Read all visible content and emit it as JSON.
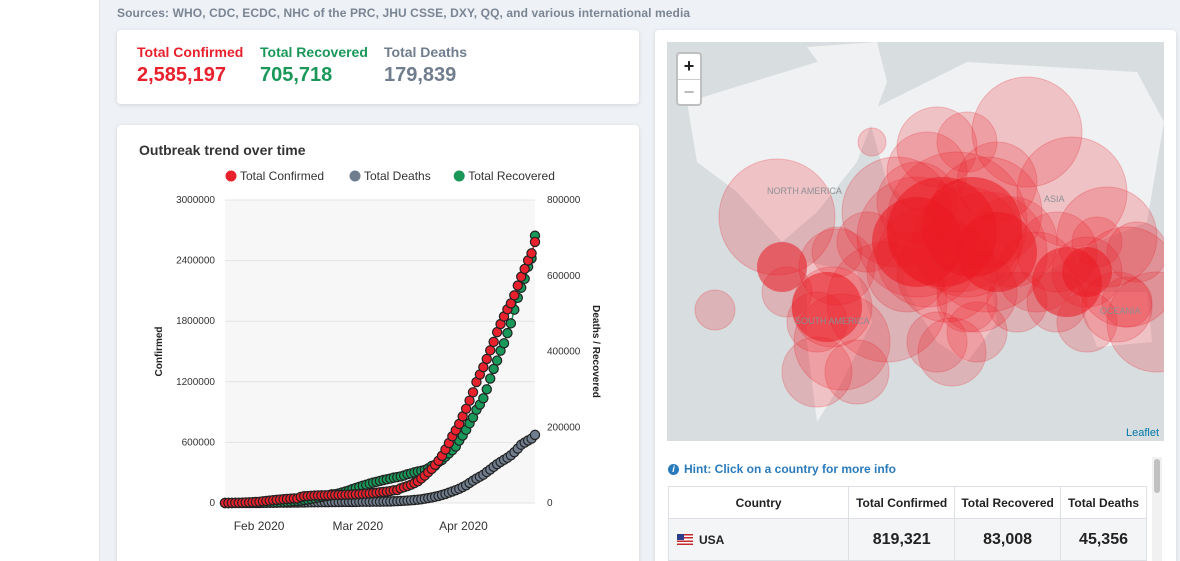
{
  "sources": "Sources: WHO, CDC, ECDC, NHC of the PRC, JHU CSSE, DXY, QQ, and various international media",
  "stats": {
    "confirmed_label": "Total Confirmed",
    "confirmed_value": "2,585,197",
    "recovered_label": "Total Recovered",
    "recovered_value": "705,718",
    "deaths_label": "Total Deaths",
    "deaths_value": "179,839",
    "colors": {
      "confirmed": "#e8212d",
      "recovered": "#19985a",
      "deaths": "#6f7d8e"
    }
  },
  "map": {
    "zoom_in": "+",
    "zoom_out": "−",
    "attribution": "Leaflet",
    "labels": [
      "NORTH AMERICA",
      "SOUTH AMERICA",
      "ASIA",
      "OCEANIA"
    ]
  },
  "hint": {
    "icon": "info-icon",
    "text": "Hint: Click on a country for more info"
  },
  "table": {
    "headers": [
      "Country",
      "Total Confirmed",
      "Total Recovered",
      "Total Deaths"
    ],
    "rows": [
      {
        "flag": "us-flag-icon",
        "country": "USA",
        "confirmed": "819,321",
        "recovered": "83,008",
        "deaths": "45,356"
      }
    ]
  },
  "chart_data": {
    "type": "line",
    "title": "Outbreak trend over time",
    "ylabel": "Confirmed",
    "y2label": "Deaths / Recovered",
    "xlabel": "",
    "x_ticks": [
      "Feb 2020",
      "Mar 2020",
      "Apr 2020"
    ],
    "y_ticks": [
      0,
      600000,
      1200000,
      1800000,
      2400000,
      3000000
    ],
    "y2_ticks": [
      0,
      200000,
      400000,
      600000,
      800000
    ],
    "ylim": [
      0,
      3000000
    ],
    "y2lim": [
      0,
      800000
    ],
    "grid": true,
    "legend_position": "top",
    "x_start": "2020-01-22",
    "x_end": "2020-04-22",
    "series": [
      {
        "name": "Total Confirmed",
        "axis": "left",
        "color": "#e8212d",
        "values": [
          555,
          654,
          941,
          1434,
          2118,
          2927,
          5578,
          6166,
          8234,
          9927,
          12038,
          16787,
          19881,
          23892,
          27635,
          30817,
          34391,
          37120,
          40150,
          42762,
          44802,
          45221,
          60368,
          66885,
          69030,
          71224,
          73258,
          75136,
          75639,
          76197,
          76819,
          78572,
          78958,
          79561,
          80406,
          81388,
          82746,
          84112,
          86011,
          88369,
          90306,
          92840,
          95120,
          97886,
          101801,
          105847,
          109821,
          113590,
          118620,
          125875,
          128352,
          145205,
          156101,
          167454,
          181574,
          197102,
          214821,
          242570,
          272208,
          304507,
          336953,
          378235,
          418045,
          467653,
          529591,
          593291,
          660706,
          720117,
          782365,
          857487,
          932605,
          1013466,
          1095917,
          1197405,
          1272115,
          1345101,
          1426096,
          1511104,
          1595350,
          1691719,
          1771514,
          1846680,
          1917320,
          1976191,
          2056054,
          2152437,
          2240191,
          2317758,
          2401379,
          2472259,
          2585197
        ]
      },
      {
        "name": "Total Deaths",
        "axis": "right",
        "color": "#6f7d8e",
        "values": [
          17,
          18,
          26,
          42,
          56,
          82,
          131,
          133,
          171,
          213,
          259,
          362,
          426,
          492,
          564,
          634,
          719,
          806,
          906,
          1013,
          1113,
          1118,
          1371,
          1523,
          1666,
          1770,
          1868,
          2007,
          2122,
          2247,
          2251,
          2458,
          2469,
          2629,
          2708,
          2770,
          2814,
          2872,
          2941,
          2996,
          3085,
          3160,
          3254,
          3348,
          3460,
          3558,
          3802,
          3988,
          4262,
          4615,
          4720,
          5404,
          5819,
          6440,
          7126,
          7905,
          8733,
          9867,
          11299,
          12973,
          14623,
          16497,
          18615,
          21181,
          23970,
          27198,
          30652,
          33925,
          37582,
          42107,
          46809,
          52983,
          58787,
          64606,
          69374,
          74565,
          81865,
          88338,
          95455,
          102525,
          108503,
          114091,
          119482,
          125984,
          134177,
          143800,
          153822,
          159510,
          165064,
          169985,
          179839
        ]
      },
      {
        "name": "Total Recovered",
        "axis": "right",
        "color": "#19985a",
        "values": [
          28,
          30,
          36,
          39,
          52,
          61,
          107,
          126,
          143,
          222,
          284,
          472,
          623,
          852,
          1124,
          1487,
          2011,
          2616,
          3244,
          3946,
          4683,
          5150,
          6295,
          8058,
          9395,
          10865,
          12583,
          14352,
          16121,
          18177,
          18890,
          22886,
          23394,
          25227,
          27905,
          30384,
          33277,
          36711,
          39782,
          42716,
          45602,
          48228,
          51170,
          53796,
          55865,
          58358,
          60694,
          62494,
          64404,
          67003,
          68324,
          70251,
          72624,
          76034,
          78088,
          80840,
          83207,
          84854,
          87256,
          91499,
          97704,
          98351,
          108000,
          113787,
          122150,
          130915,
          139415,
          149082,
          164566,
          178034,
          193177,
          210263,
          225796,
          246152,
          260012,
          276515,
          300054,
          328661,
          353975,
          376096,
          402110,
          421722,
          448655,
          474261,
          510359,
          541814,
          568343,
          591986,
          623903,
          645738,
          705718
        ]
      }
    ]
  }
}
